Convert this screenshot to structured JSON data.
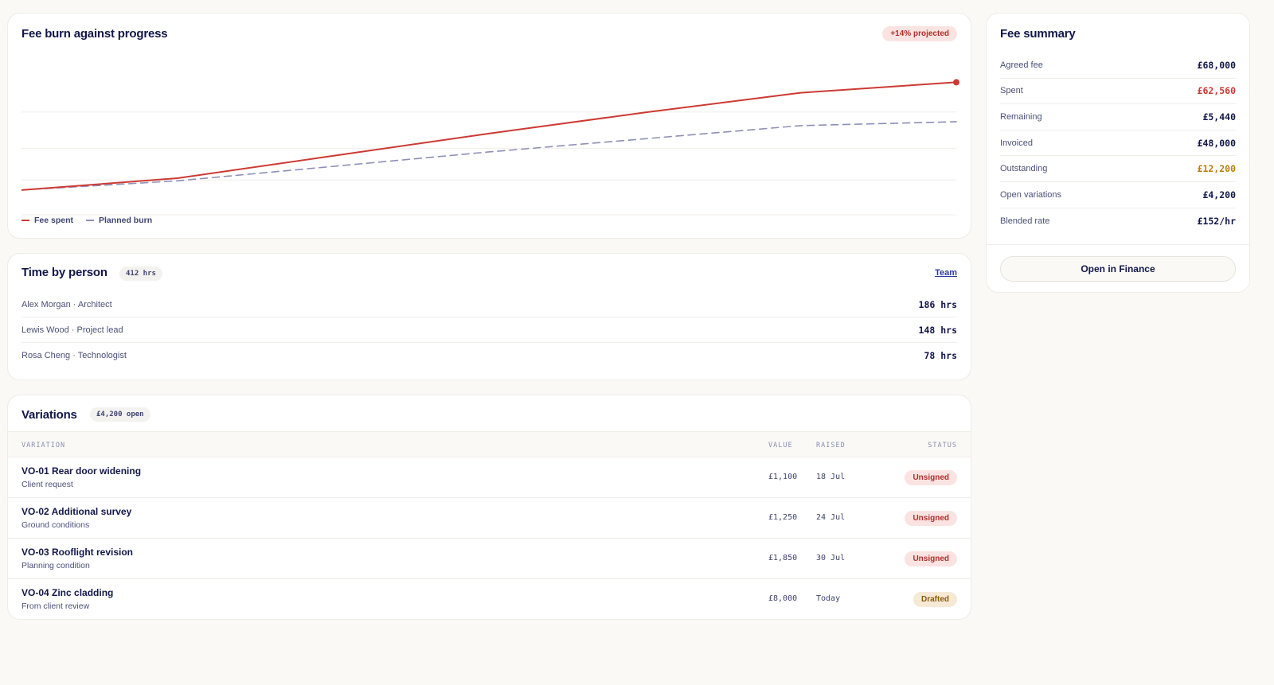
{
  "burn": {
    "title": "Fee burn against progress",
    "projected_badge": "+14% projected",
    "legend": {
      "spent": "Fee spent",
      "planned": "Planned burn"
    },
    "colors": {
      "spent": "#cc3a33",
      "planned": "#8d8fb8"
    }
  },
  "chart_data": {
    "type": "line",
    "x": [
      0,
      1,
      2,
      3,
      4,
      5,
      6
    ],
    "series": [
      {
        "name": "Fee spent",
        "values": [
          14,
          23,
          40,
          57,
          73,
          88,
          96
        ]
      },
      {
        "name": "Planned burn",
        "values": [
          14,
          21,
          32,
          43,
          53,
          63,
          66
        ]
      }
    ],
    "ylim": [
      0,
      115
    ],
    "grid": true,
    "legend": "bottom-left"
  },
  "time": {
    "title": "Time by person",
    "total": "412 hrs",
    "team_link": "Team",
    "people": [
      {
        "label": "Alex Morgan · Architect",
        "hours": "186 hrs"
      },
      {
        "label": "Lewis Wood · Project lead",
        "hours": "148 hrs"
      },
      {
        "label": "Rosa Cheng · Technologist",
        "hours": "78 hrs"
      }
    ]
  },
  "variations": {
    "title": "Variations",
    "open_pill": "£4,200 open",
    "headers": {
      "variation": "VARIATION",
      "value": "VALUE",
      "raised": "RAISED",
      "status": "STATUS"
    },
    "rows": [
      {
        "name": "VO-01 Rear door widening",
        "sub": "Client request",
        "value": "£1,100",
        "raised": "18 Jul",
        "status": "Unsigned",
        "status_kind": "unsigned"
      },
      {
        "name": "VO-02 Additional survey",
        "sub": "Ground conditions",
        "value": "£1,250",
        "raised": "24 Jul",
        "status": "Unsigned",
        "status_kind": "unsigned"
      },
      {
        "name": "VO-03 Rooflight revision",
        "sub": "Planning condition",
        "value": "£1,850",
        "raised": "30 Jul",
        "status": "Unsigned",
        "status_kind": "unsigned"
      },
      {
        "name": "VO-04 Zinc cladding",
        "sub": "From client review",
        "value": "£8,000",
        "raised": "Today",
        "status": "Drafted",
        "status_kind": "drafted"
      }
    ]
  },
  "summary": {
    "title": "Fee summary",
    "rows": [
      {
        "label": "Agreed fee",
        "value": "£68,000",
        "color": "#12174a"
      },
      {
        "label": "Spent",
        "value": "£62,560",
        "color": "#cc3a33"
      },
      {
        "label": "Remaining",
        "value": "£5,440",
        "color": "#12174a"
      },
      {
        "label": "Invoiced",
        "value": "£48,000",
        "color": "#12174a"
      },
      {
        "label": "Outstanding",
        "value": "£12,200",
        "color": "#b7800a"
      },
      {
        "label": "Open variations",
        "value": "£4,200",
        "color": "#12174a"
      },
      {
        "label": "Blended rate",
        "value": "£152/hr",
        "color": "#12174a"
      }
    ],
    "button": "Open in Finance"
  }
}
